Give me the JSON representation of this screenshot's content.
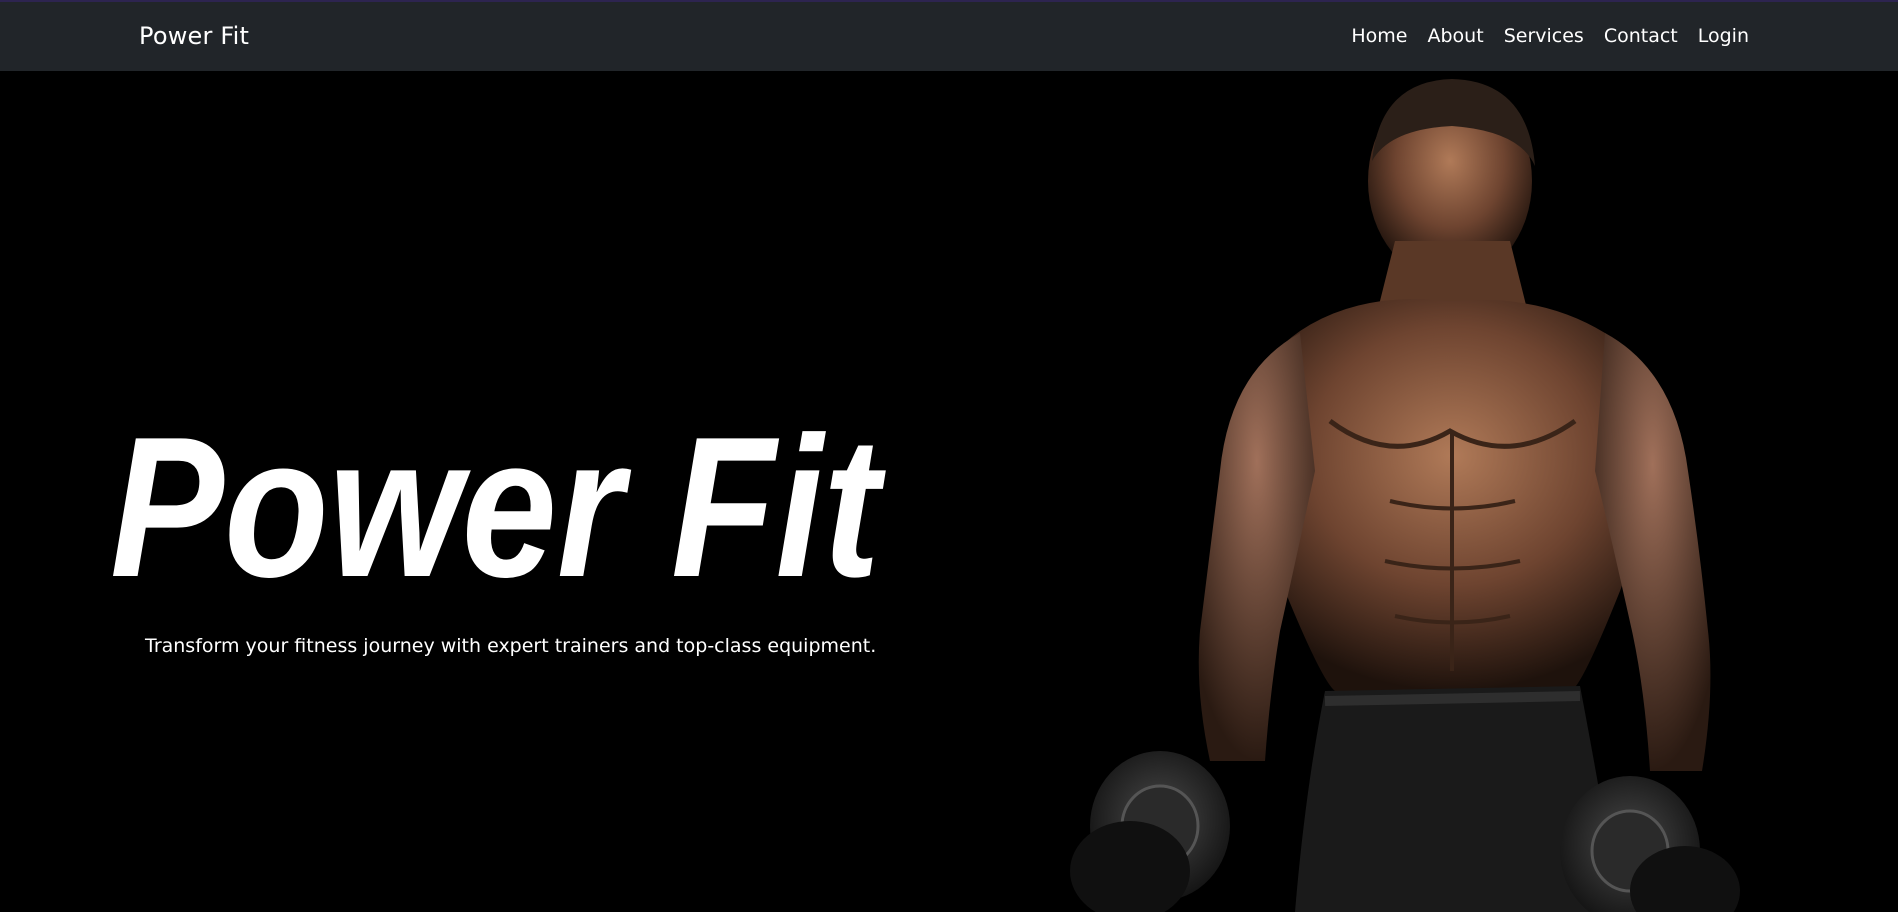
{
  "navbar": {
    "brand": "Power Fit",
    "links": [
      {
        "label": "Home"
      },
      {
        "label": "About"
      },
      {
        "label": "Services"
      },
      {
        "label": "Contact"
      },
      {
        "label": "Login"
      }
    ]
  },
  "hero": {
    "title": "Power Fit",
    "tagline": "Transform your fitness journey with expert trainers and top-class equipment."
  },
  "colors": {
    "navbar_bg": "#212529",
    "page_bg": "#000000",
    "text": "#ffffff"
  }
}
